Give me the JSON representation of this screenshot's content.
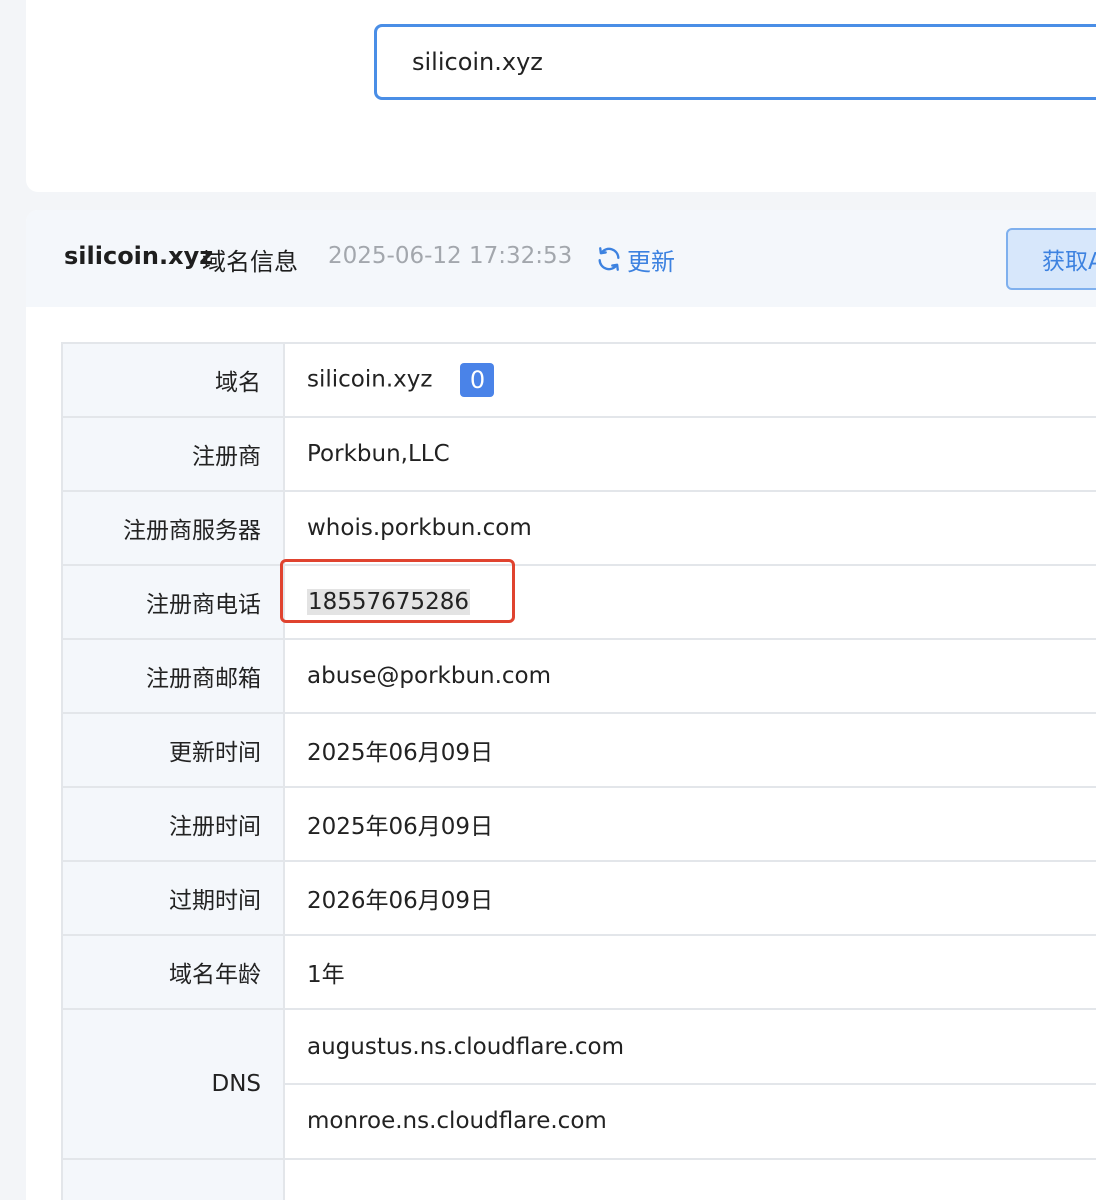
{
  "search": {
    "value": "silicoin.xyz"
  },
  "header": {
    "domain": "silicoin.xyz",
    "title": "域名信息",
    "timestamp": "2025-06-12 17:32:53",
    "refresh_label": "更新",
    "fetch_button_label": "获取A"
  },
  "table": {
    "domain": {
      "label": "域名",
      "value": "silicoin.xyz",
      "badge": "0"
    },
    "registrar": {
      "label": "注册商",
      "value": "Porkbun,LLC"
    },
    "registrar_server": {
      "label": "注册商服务器",
      "value": "whois.porkbun.com"
    },
    "registrar_phone": {
      "label": "注册商电话",
      "value": "18557675286"
    },
    "registrar_email": {
      "label": "注册商邮箱",
      "value": "abuse@porkbun.com"
    },
    "updated_date": {
      "label": "更新时间",
      "value": "2025年06月09日"
    },
    "created_date": {
      "label": "注册时间",
      "value": "2025年06月09日"
    },
    "expiry_date": {
      "label": "过期时间",
      "value": "2026年06月09日"
    },
    "domain_age": {
      "label": "域名年龄",
      "value": "1年"
    },
    "dns": {
      "label": "DNS",
      "servers": [
        "augustus.ns.cloudflare.com",
        "monroe.ns.cloudflare.com"
      ]
    }
  },
  "colors": {
    "accent": "#3d82e0",
    "input_border": "#4a8ee6",
    "badge": "#4a83e8",
    "highlight": "#e0432f"
  },
  "icons": {
    "refresh": "refresh-icon"
  }
}
